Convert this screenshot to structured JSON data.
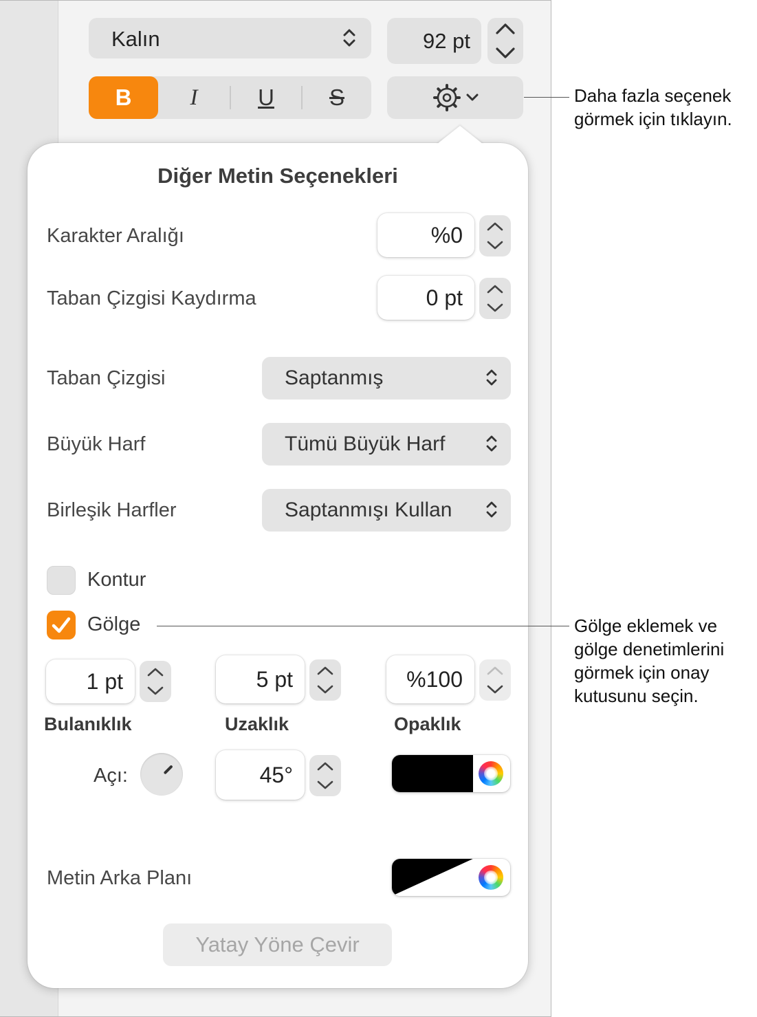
{
  "toolbar": {
    "font_style": "Kalın",
    "font_size": "92 pt",
    "bold_label": "B",
    "italic_label": "I",
    "underline_label": "U",
    "strikethrough_label": "S"
  },
  "popover": {
    "title": "Diğer Metin Seçenekleri",
    "character_spacing": {
      "label": "Karakter Aralığı",
      "value": "%0"
    },
    "baseline_shift": {
      "label": "Taban Çizgisi Kaydırma",
      "value": "0 pt"
    },
    "baseline": {
      "label": "Taban Çizgisi",
      "value": "Saptanmış"
    },
    "capitalization": {
      "label": "Büyük Harf",
      "value": "Tümü Büyük Harf"
    },
    "ligatures": {
      "label": "Birleşik Harfler",
      "value": "Saptanmışı Kullan"
    },
    "outline": {
      "label": "Kontur",
      "checked": false
    },
    "shadow": {
      "label": "Gölge",
      "checked": true,
      "blur": {
        "label": "Bulanıklık",
        "value": "1 pt"
      },
      "offset": {
        "label": "Uzaklık",
        "value": "5 pt"
      },
      "opacity": {
        "label": "Opaklık",
        "value": "%100"
      },
      "angle": {
        "label": "Açı:",
        "value": "45°"
      },
      "color": "#000000"
    },
    "text_background": {
      "label": "Metin Arka Planı"
    },
    "rotate_button": "Yatay Yöne Çevir"
  },
  "callouts": {
    "more_options": [
      "Daha fazla seçenek",
      "görmek için tıklayın."
    ],
    "shadow": [
      "Gölge eklemek ve",
      "gölge denetimlerini",
      "görmek için onay",
      "kutusunu seçin."
    ]
  },
  "colors": {
    "accent": "#F7870E",
    "panel_bg": "#FFFFFF",
    "control_bg": "#E3E3E3"
  }
}
